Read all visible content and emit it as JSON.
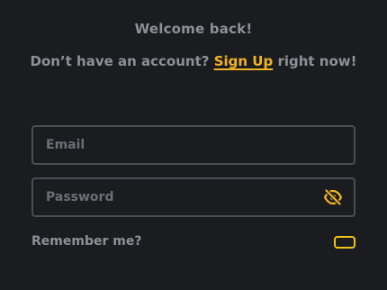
{
  "header": {
    "title": "Welcome back!",
    "signup_prefix": "Don’t have an account?",
    "signup_link": "Sign Up",
    "signup_suffix": "right now!"
  },
  "form": {
    "email_placeholder": "Email",
    "email_value": "",
    "password_placeholder": "Password",
    "password_value": "",
    "password_visibility_icon": "eye-off-icon",
    "remember_label": "Remember me?",
    "remember_checked": false
  },
  "colors": {
    "background": "#1b1c20",
    "text_muted": "#8f9095",
    "accent": "#f0b323",
    "field_border": "#4c4d52"
  }
}
